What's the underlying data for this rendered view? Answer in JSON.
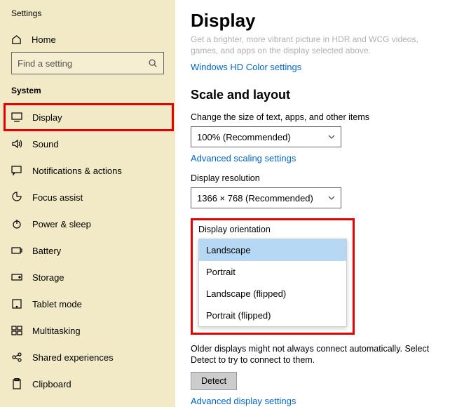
{
  "app_title": "Settings",
  "home_label": "Home",
  "search_placeholder": "Find a setting",
  "group_header": "System",
  "nav": {
    "0": "Display",
    "1": "Sound",
    "2": "Notifications & actions",
    "3": "Focus assist",
    "4": "Power & sleep",
    "5": "Battery",
    "6": "Storage",
    "7": "Tablet mode",
    "8": "Multitasking",
    "9": "Shared experiences",
    "10": "Clipboard"
  },
  "main": {
    "title": "Display",
    "desc": "Get a brighter, more vibrant picture in HDR and WCG videos, games, and apps on the display selected above.",
    "hdr_link": "Windows HD Color settings",
    "section_scale": "Scale and layout",
    "scale_label": "Change the size of text, apps, and other items",
    "scale_value": "100% (Recommended)",
    "adv_scaling": "Advanced scaling settings",
    "res_label": "Display resolution",
    "res_value": "1366 × 768 (Recommended)",
    "orient_label": "Display orientation",
    "orient_options": {
      "0": "Landscape",
      "1": "Portrait",
      "2": "Landscape (flipped)",
      "3": "Portrait (flipped)"
    },
    "detect_note": "Older displays might not always connect automatically. Select Detect to try to connect to them.",
    "detect_btn": "Detect",
    "adv_display": "Advanced display settings"
  }
}
